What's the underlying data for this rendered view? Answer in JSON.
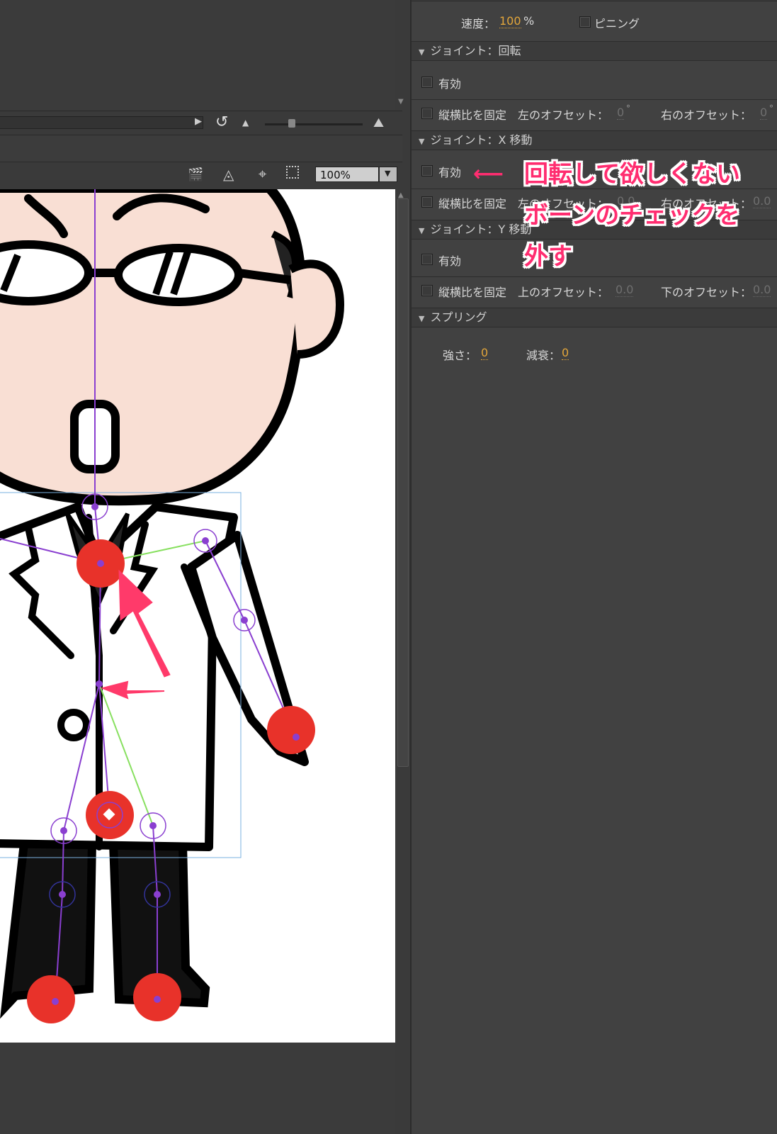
{
  "stage": {
    "zoom": "100%"
  },
  "panel": {
    "speed_label": "速度：",
    "speed_value": "100",
    "speed_unit": "%",
    "pinning_label": "ピニング",
    "sections": {
      "rotation_header": "ジョイント：回転",
      "x_header": "ジョイント：X 移動",
      "y_header": "ジョイント：Y 移動",
      "spring_header": "スプリング"
    },
    "rotation": {
      "enabled_label": "有効",
      "lock_aspect_label": "縦横比を固定",
      "left_offset_label": "左のオフセット：",
      "left_offset_value": "0",
      "left_offset_unit": "°",
      "right_offset_label": "右のオフセット：",
      "right_offset_value": "0",
      "right_offset_unit": "°"
    },
    "x_move": {
      "enabled_label": "有効",
      "lock_aspect_label": "縦横比を固定",
      "left_offset_label": "左のオフセット：",
      "left_offset_value": "0.0",
      "right_offset_label": "右のオフセット：",
      "right_offset_value": "0.0"
    },
    "y_move": {
      "enabled_label": "有効",
      "lock_aspect_label": "縦横比を固定",
      "top_offset_label": "上のオフセット：",
      "top_offset_value": "0.0",
      "bottom_offset_label": "下のオフセット：",
      "bottom_offset_value": "0.0"
    },
    "spring": {
      "strength_label": "強さ：",
      "strength_value": "0",
      "damping_label": "減衰：",
      "damping_value": "0"
    }
  },
  "annotation": {
    "line1": "回転して欲しくない",
    "line2": "ボーンのチェックを",
    "line3": "外す"
  },
  "colors": {
    "accent_value": "#e3a63a",
    "annotation": "#ff2d70",
    "bone": "#8a3fd0",
    "bone_child": "#88e060",
    "joint_dot": "#e8322a",
    "skin": "#f9dfd4"
  }
}
